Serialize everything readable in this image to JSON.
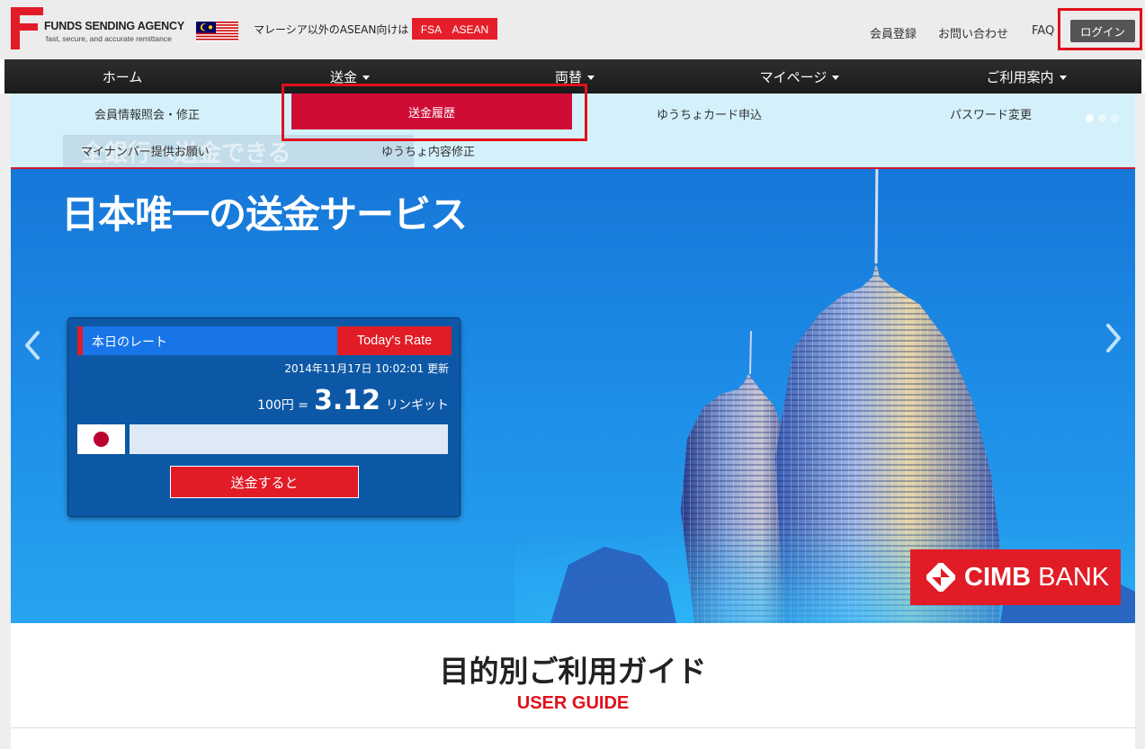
{
  "header": {
    "logo_name": "FUNDS SENDING AGENCY",
    "logo_tagline": "fast, secure, and accurate remittance",
    "asean_text": "マレーシア以外のASEAN向けは",
    "asean_button": "FSA　ASEAN",
    "links": [
      "会員登録",
      "お問い合わせ",
      "FAQ"
    ],
    "login": "ログイン"
  },
  "nav": {
    "items": [
      {
        "label": "ホーム",
        "dropdown": false
      },
      {
        "label": "送金",
        "dropdown": true
      },
      {
        "label": "両替",
        "dropdown": true
      },
      {
        "label": "マイページ",
        "dropdown": true
      },
      {
        "label": "ご利用案内",
        "dropdown": true
      }
    ]
  },
  "submenu": {
    "row1": [
      "会員情報照会・修正",
      "送金履歴",
      "ゆうちょカード申込",
      "パスワード変更"
    ],
    "row2": [
      "マイナンバー提供お願い",
      "ゆうちょ内容修正"
    ],
    "active": "送金履歴"
  },
  "hero": {
    "ghost_text": "全銀行へ送金できる",
    "title": "日本唯一の送金サービス",
    "bank_name_bold": "CIMB",
    "bank_name_rest": " BANK"
  },
  "rate": {
    "label": "本日のレート",
    "tab": "Today's Rate",
    "updated": "2014年11月17日 10:02:01 更新",
    "base": "100円 =",
    "value": "3.12",
    "unit": "リンギット",
    "input_value": "",
    "send_button": "送金すると"
  },
  "guide": {
    "title": "目的別ご利用ガイド",
    "subtitle": "USER GUIDE"
  },
  "colors": {
    "brand_red": "#e11c26",
    "highlight_red": "#e0101c",
    "nav_dark": "#222222",
    "submenu_bg": "#d4f1fb",
    "rate_blue": "#0d58a6"
  }
}
